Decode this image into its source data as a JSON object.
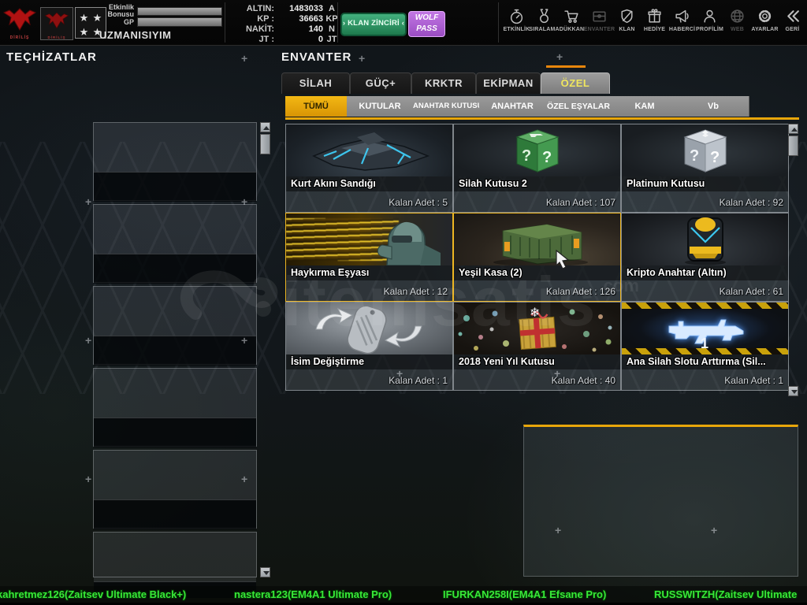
{
  "top_bar": {
    "logo_sub": "DİRİLİŞ",
    "etkinlik_label_line1": "Etkinlik",
    "etkinlik_label_line2": "Bonusu",
    "gp_label": "GP",
    "rank_name": "UZMANISIYIM",
    "currencies": [
      {
        "label": "ALTIN:",
        "value": "1483033",
        "unit": "A"
      },
      {
        "label": "KP :",
        "value": "36663",
        "unit": "KP"
      },
      {
        "label": "NAKİT:",
        "value": "140",
        "unit": "N"
      },
      {
        "label": "JT :",
        "value": "0",
        "unit": "JT"
      }
    ],
    "klan_zinciri_button": "› KLAN ZİNCİRİ ‹",
    "wolf_pass_button": "WOLF PASS",
    "nav": [
      {
        "label": "ETKİNLİK"
      },
      {
        "label": "SIRALAMA"
      },
      {
        "label": "DÜKKAN"
      },
      {
        "label": "ENVANTER"
      },
      {
        "label": "KLAN"
      },
      {
        "label": "HEDİYE"
      },
      {
        "label": "HABERCİ"
      },
      {
        "label": "PROFİLİM"
      },
      {
        "label": "WEB"
      },
      {
        "label": "AYARLAR"
      },
      {
        "label": "GERİ"
      }
    ]
  },
  "left_panel": {
    "title": "TEÇHİZATLAR"
  },
  "inventory": {
    "title": "ENVANTER",
    "tabs": [
      {
        "label": "SİLAH"
      },
      {
        "label": "GÜÇ+"
      },
      {
        "label": "KRKTR"
      },
      {
        "label": "EKİPMAN"
      },
      {
        "label": "ÖZEL"
      }
    ],
    "subtabs": [
      {
        "label": "TÜMÜ"
      },
      {
        "label": "KUTULAR"
      },
      {
        "label": "ANAHTAR KUTUSU"
      },
      {
        "label": "ANAHTAR"
      },
      {
        "label": "ÖZEL EŞYALAR"
      },
      {
        "label": "KAM"
      },
      {
        "label": "Vb"
      }
    ],
    "count_label": "Kalan Adet :",
    "items": [
      {
        "name": "Kurt Akını Sandığı",
        "count": "5"
      },
      {
        "name": "Silah Kutusu 2",
        "count": "107"
      },
      {
        "name": "Platinum Kutusu",
        "count": "92"
      },
      {
        "name": "Haykırma Eşyası",
        "count": "12"
      },
      {
        "name": "Yeşil Kasa (2)",
        "count": "126"
      },
      {
        "name": "Kripto Anahtar (Altın)",
        "count": "61"
      },
      {
        "name": "İsim Değiştirme",
        "count": "1"
      },
      {
        "name": "2018 Yeni Yıl Kutusu",
        "count": "40"
      },
      {
        "name": "Ana Silah Slotu Arttırma (Sil...",
        "count": "1"
      }
    ]
  },
  "ticker": [
    "kahretmez126(Zaitsev Ultimate Black+)",
    "nastera123(EM4A1 Ultimate Pro)",
    "IFURKAN258I(EM4A1 Efsane Pro)",
    "RUSSWITZH(Zaitsev Ultimate"
  ],
  "watermark": {
    "text": "itemsatis",
    "suffix": ".com"
  },
  "decor": {
    "plus": "+",
    "star": "★",
    "question_mark": "?",
    "snowflake": "❄",
    "slot_number": "1"
  },
  "colors": {
    "accent_orange": "#e8a60a",
    "tab_active_text": "#f0e65e",
    "ticker_green": "#38e838",
    "klan_green": "#2f9b67",
    "wolfpass_purple": "#b266d9"
  }
}
